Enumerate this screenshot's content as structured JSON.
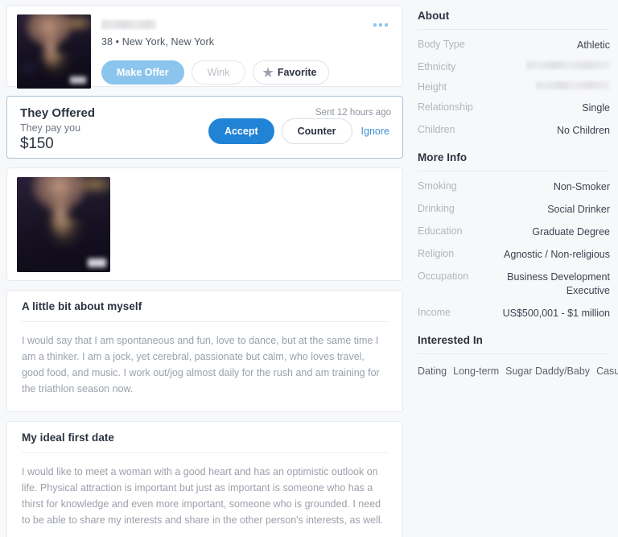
{
  "colors": {
    "page_bg": "#f7f8fa",
    "card_bg": "#ffffff",
    "accent_blue": "#2083d5",
    "accent_blue_light": "#8bc5ee",
    "link_blue": "#3f8fd4",
    "offer_card_border": "#aac4da",
    "muted_text": "#9aa1ab",
    "label_text": "#b0b6be"
  },
  "profile_header": {
    "name": "",
    "name_redacted": true,
    "subline": "38 • New York, New York",
    "avatar_alt": "profile-photo",
    "buttons": {
      "make_offer": "Make Offer",
      "wink": "Wink",
      "favorite": "Favorite"
    },
    "favorite_icon": "star-icon",
    "more_icon": "kebab-menu-icon"
  },
  "offer": {
    "title": "They Offered",
    "subtitle": "They pay you",
    "amount": "$150",
    "sent": "Sent 12 hours ago",
    "accept_label": "Accept",
    "counter_label": "Counter",
    "ignore_label": "Ignore"
  },
  "photos": {
    "thumb_alt": "profile-photo-thumbnail"
  },
  "sections": [
    {
      "title": "A little bit about myself",
      "body": "I would say that I am spontaneous and fun, love to dance, but at the same time I am a thinker. I am a jock, yet cerebral, passionate but calm, who loves travel, good food, and music. I work out/jog almost daily for the rush and am training for the triathlon season now."
    },
    {
      "title": "My ideal first date",
      "body": "I would like to meet a woman with a good heart and has an optimistic outlook on life. Physical attraction is important but just as important is someone who has a thirst for knowledge and even more important, someone who is grounded. I need to be able to share my interests and share in the other person's interests, as well."
    }
  ],
  "about": {
    "title": "About",
    "rows": [
      {
        "key": "Body Type",
        "value": "Athletic",
        "redacted": false
      },
      {
        "key": "Ethnicity",
        "value": "",
        "redacted": true
      },
      {
        "key": "Height",
        "value": "",
        "redacted": true
      },
      {
        "key": "Relationship",
        "value": "Single",
        "redacted": false
      },
      {
        "key": "Children",
        "value": "No Children",
        "redacted": false
      }
    ]
  },
  "more_info": {
    "title": "More Info",
    "rows": [
      {
        "key": "Smoking",
        "value": "Non-Smoker"
      },
      {
        "key": "Drinking",
        "value": "Social Drinker"
      },
      {
        "key": "Education",
        "value": "Graduate Degree"
      },
      {
        "key": "Religion",
        "value": "Agnostic / Non-religious"
      },
      {
        "key": "Occupation",
        "value": "Business Development Executive"
      },
      {
        "key": "Income",
        "value": "US$500,001 - $1 million"
      }
    ]
  },
  "interested_in": {
    "title": "Interested In",
    "tags": [
      "Dating",
      "Long-term",
      "Sugar Daddy/Baby",
      "Casual dating"
    ]
  }
}
